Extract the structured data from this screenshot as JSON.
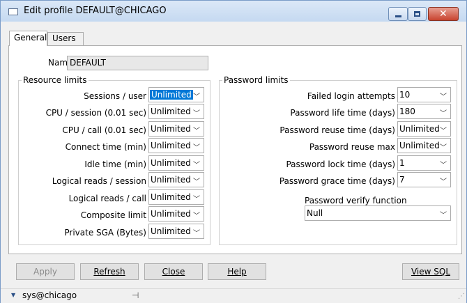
{
  "window": {
    "title": "Edit profile DEFAULT@CHICAGO"
  },
  "tabs": [
    {
      "label": "General"
    },
    {
      "label": "Users"
    }
  ],
  "general": {
    "name_label": "Name",
    "name_value": "DEFAULT",
    "resource_limits": {
      "title": "Resource limits",
      "rows": [
        {
          "label": "Sessions / user",
          "value": "Unlimited"
        },
        {
          "label": "CPU / session (0.01 sec)",
          "value": "Unlimited"
        },
        {
          "label": "CPU / call (0.01 sec)",
          "value": "Unlimited"
        },
        {
          "label": "Connect time (min)",
          "value": "Unlimited"
        },
        {
          "label": "Idle time (min)",
          "value": "Unlimited"
        },
        {
          "label": "Logical reads / session",
          "value": "Unlimited"
        },
        {
          "label": "Logical reads / call",
          "value": "Unlimited"
        },
        {
          "label": "Composite limit",
          "value": "Unlimited"
        },
        {
          "label": "Private SGA (Bytes)",
          "value": "Unlimited"
        }
      ]
    },
    "password_limits": {
      "title": "Password limits",
      "rows": [
        {
          "label": "Failed login attempts",
          "value": "10"
        },
        {
          "label": "Password life time (days)",
          "value": "180"
        },
        {
          "label": "Password reuse time (days)",
          "value": "Unlimited"
        },
        {
          "label": "Password reuse max",
          "value": "Unlimited"
        },
        {
          "label": "Password lock time (days)",
          "value": "1"
        },
        {
          "label": "Password grace time (days)",
          "value": "7"
        }
      ],
      "verify_function_label": "Password verify function",
      "verify_function_value": "Null"
    }
  },
  "buttons": {
    "apply": {
      "label": "Apply",
      "enabled": false
    },
    "refresh": "Refresh",
    "close": "Close",
    "help": "Help",
    "view_sql": "View SQL"
  },
  "statusbar": {
    "connection": "sys@chicago"
  },
  "icons": {
    "pin": "pin-icon",
    "collapse": "triangle-down-icon",
    "grip": "resize-grip-icon"
  },
  "colors": {
    "selection": "#0078d7",
    "close_button": "#c8432f",
    "titlebar": "#c5d9f1"
  }
}
